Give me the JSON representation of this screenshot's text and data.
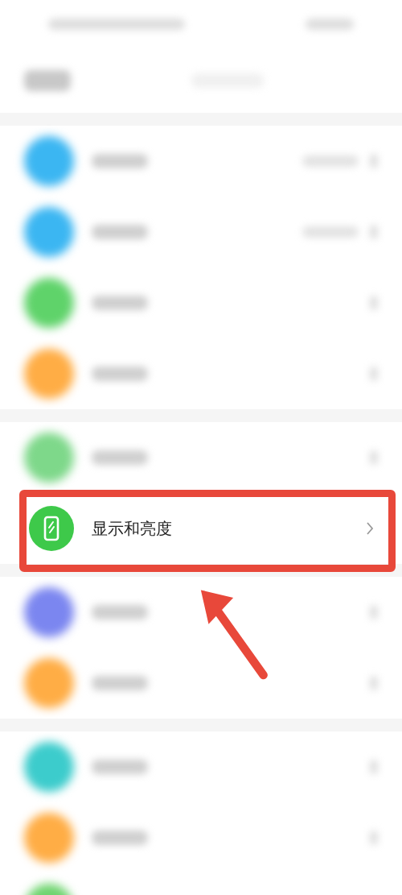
{
  "sections": [
    {
      "rows": [
        {
          "kind": "blurred",
          "color": "#3bb6f2",
          "has_value": true
        },
        {
          "kind": "blurred",
          "color": "#3bb6f2",
          "has_value": true
        },
        {
          "kind": "blurred",
          "color": "#5fd36a",
          "has_value": false
        },
        {
          "kind": "blurred",
          "color": "#ffad45",
          "has_value": false
        }
      ]
    },
    {
      "rows": [
        {
          "kind": "blurred",
          "color": "#7ed88a",
          "has_value": false
        },
        {
          "kind": "clear",
          "color": "#3ec94a",
          "label": "显示和亮度",
          "has_value": false,
          "highlighted": true
        }
      ]
    },
    {
      "rows": [
        {
          "kind": "blurred",
          "color": "#7b86f0",
          "has_value": false
        },
        {
          "kind": "blurred",
          "color": "#ffad45",
          "has_value": false
        }
      ]
    },
    {
      "rows": [
        {
          "kind": "blurred",
          "color": "#3ccccc",
          "has_value": false
        },
        {
          "kind": "blurred",
          "color": "#ffad45",
          "has_value": false
        },
        {
          "kind": "blurred",
          "color": "#6fd46f",
          "has_value": false
        }
      ]
    }
  ]
}
